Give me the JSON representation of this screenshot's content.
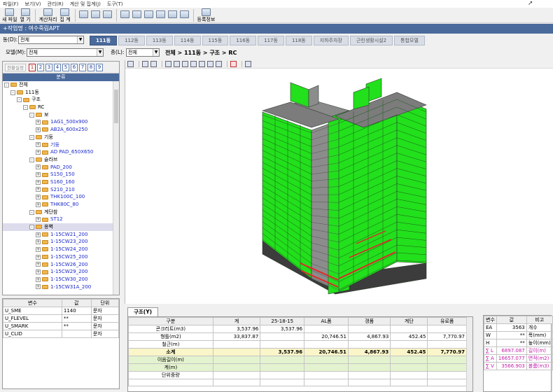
{
  "menu": [
    "파일(F)",
    "보기(V)",
    "관리(R)",
    "계산 및 집계(J)",
    "도구(T)"
  ],
  "toolbar": {
    "new_file": "새 파일",
    "open": "열 기",
    "calc_run": "계산처리",
    "aggregate": "집 계",
    "register_info": "등록정보"
  },
  "title": "+작업명 : 여수죽림APT",
  "building": {
    "label": "동(D):",
    "value": "전체",
    "tabs": [
      "111동",
      "112동",
      "113동",
      "114동",
      "115동",
      "116동",
      "117동",
      "118동",
      "지하주차장",
      "근린생활시설2",
      "통합모델"
    ],
    "active_index": 0
  },
  "model": {
    "label": "모델(M):",
    "value": "전체"
  },
  "floor": {
    "label": "층(L):",
    "value": "전체"
  },
  "breadcrumb": "전체 > 111동 > 구조 > RC",
  "left_toolbar": {
    "placement": "현황실정",
    "numbers": [
      "1",
      "2",
      "3",
      "4",
      "5",
      "6",
      "7",
      "8",
      "9"
    ],
    "active_number_index": 0
  },
  "tree": {
    "header": "분류",
    "nodes": [
      {
        "label": "전체",
        "depth": 0,
        "toggle": "-",
        "blue": false
      },
      {
        "label": "111동",
        "depth": 1,
        "toggle": "-",
        "blue": false
      },
      {
        "label": "구조",
        "depth": 2,
        "toggle": "-",
        "blue": false
      },
      {
        "label": "RC",
        "depth": 3,
        "toggle": "-",
        "blue": false
      },
      {
        "label": "보",
        "depth": 4,
        "toggle": "-",
        "blue": false
      },
      {
        "label": "1AG1_500x900",
        "depth": 5,
        "toggle": "+",
        "blue": true
      },
      {
        "label": "AB2A_600x250",
        "depth": 5,
        "toggle": "+",
        "blue": true
      },
      {
        "label": "기둥",
        "depth": 4,
        "toggle": "-",
        "blue": false
      },
      {
        "label": "기둥",
        "depth": 5,
        "toggle": "+",
        "blue": true
      },
      {
        "label": "AD PAD_650X650",
        "depth": 5,
        "toggle": "+",
        "blue": true
      },
      {
        "label": "슬라브",
        "depth": 4,
        "toggle": "-",
        "blue": false
      },
      {
        "label": "PAD_200",
        "depth": 5,
        "toggle": "+",
        "blue": true
      },
      {
        "label": "S150_150",
        "depth": 5,
        "toggle": "+",
        "blue": true
      },
      {
        "label": "S160_160",
        "depth": 5,
        "toggle": "+",
        "blue": true
      },
      {
        "label": "S210_210",
        "depth": 5,
        "toggle": "+",
        "blue": true
      },
      {
        "label": "THK100C_100",
        "depth": 5,
        "toggle": "+",
        "blue": true
      },
      {
        "label": "THK80C_80",
        "depth": 5,
        "toggle": "+",
        "blue": true
      },
      {
        "label": "계단참",
        "depth": 4,
        "toggle": "-",
        "blue": false
      },
      {
        "label": "ST12",
        "depth": 5,
        "toggle": "+",
        "blue": true
      },
      {
        "label": "옹벽",
        "depth": 4,
        "toggle": "-",
        "blue": false,
        "selected": true
      },
      {
        "label": "1-15CW21_200",
        "depth": 5,
        "toggle": "+",
        "blue": true
      },
      {
        "label": "1-15CW23_200",
        "depth": 5,
        "toggle": "+",
        "blue": true
      },
      {
        "label": "1-15CW24_200",
        "depth": 5,
        "toggle": "+",
        "blue": true
      },
      {
        "label": "1-15CW25_200",
        "depth": 5,
        "toggle": "+",
        "blue": true
      },
      {
        "label": "1-15CW26_200",
        "depth": 5,
        "toggle": "+",
        "blue": true
      },
      {
        "label": "1-15CW29_200",
        "depth": 5,
        "toggle": "+",
        "blue": true
      },
      {
        "label": "1-15CW30_200",
        "depth": 5,
        "toggle": "+",
        "blue": true
      },
      {
        "label": "1-15CW31A_200",
        "depth": 5,
        "toggle": "+",
        "blue": true
      }
    ]
  },
  "var_table": {
    "headers": [
      "변수",
      "값",
      "단위"
    ],
    "rows": [
      [
        "U_SME",
        "1140",
        "문자"
      ],
      [
        "U_FLEVEL",
        "**",
        "문자"
      ],
      [
        "U_SMARK",
        "**",
        "문자"
      ],
      [
        "U_CLID",
        "",
        "문자"
      ]
    ]
  },
  "bottom": {
    "tab": "구조(Y)",
    "headers": [
      "구분",
      "계",
      "25-18-15",
      "AL폼",
      "갱폼",
      "계단",
      "유로폼"
    ],
    "rows": [
      [
        "콘크리트(m3)",
        "3,537.96",
        "3,537.96",
        "",
        "",
        "",
        ""
      ],
      [
        "형틀(m2)",
        "33,837.87",
        "",
        "20,746.51",
        "4,867.93",
        "452.45",
        "7,770.97"
      ],
      [
        "철근(m)",
        "",
        "",
        "",
        "",
        "",
        ""
      ],
      [
        "소계",
        "",
        "3,537.96",
        "20,746.51",
        "4,867.93",
        "452.45",
        "7,770.97"
      ],
      [
        "이음길이(m)",
        "",
        "",
        "",
        "",
        "",
        ""
      ],
      [
        "계(m)",
        "",
        "",
        "",
        "",
        "",
        ""
      ],
      [
        "단위중량",
        "",
        "",
        "",
        "",
        "",
        ""
      ],
      [
        "",
        "",
        "",
        "",
        "",
        "",
        ""
      ]
    ]
  },
  "props": {
    "headers": [
      "변수",
      "값",
      "비고"
    ],
    "rows": [
      [
        "EA",
        "3563",
        "개수"
      ],
      [
        "W",
        "**",
        "폭(mm)"
      ],
      [
        "H",
        "**",
        "높이(mm)"
      ],
      [
        "∑ L",
        "6897.087",
        "길이(m)"
      ],
      [
        "∑ A",
        "16657.077",
        "면적(m2)"
      ],
      [
        "∑ V",
        "3566.903",
        "볼륨(m3)"
      ]
    ]
  },
  "colors": {
    "accent": "#4a6a9c",
    "model_green": "#22e01c",
    "model_gray": "#8c8c8c",
    "highlight_red": "#e0282a"
  }
}
